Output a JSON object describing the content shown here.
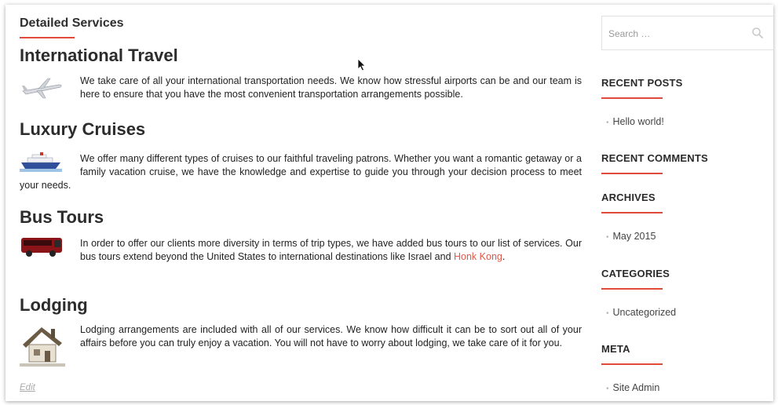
{
  "page": {
    "title": "Detailed Services",
    "edit_label": "Edit"
  },
  "sections": [
    {
      "heading": "International Travel",
      "icon": "airplane-icon",
      "text": "We take care of all your international transportation needs.  We know how stressful airports can be and our team is here to ensure that you have the most convenient transportation arrangements possible."
    },
    {
      "heading": "Luxury Cruises",
      "icon": "cruise-ship-icon",
      "text": "We offer many different types of cruises to our faithful traveling patrons.  Whether you want a romantic getaway or a family vacation cruise, we have the knowledge and expertise to guide you through your decision process to meet your needs."
    },
    {
      "heading": "Bus Tours",
      "icon": "bus-icon",
      "text_before_link": "In order to offer our clients more diversity in terms of trip types, we have added bus tours to our list of services.  Our bus tours extend beyond the United States to international destinations like Israel and ",
      "link": "Honk Kong",
      "text_after_link": "."
    },
    {
      "heading": "Lodging",
      "icon": "house-icon",
      "text": "Lodging arrangements are included with all of our services.  We know how difficult it can be to sort out all of your affairs before you can truly enjoy a vacation.  You will not have to worry about lodging, we take care of it for you."
    }
  ],
  "sidebar": {
    "search": {
      "placeholder": "Search …"
    },
    "recent_posts": {
      "heading": "RECENT POSTS",
      "items": [
        "Hello world!"
      ]
    },
    "recent_comments": {
      "heading": "RECENT COMMENTS"
    },
    "archives": {
      "heading": "ARCHIVES",
      "items": [
        "May 2015"
      ]
    },
    "categories": {
      "heading": "CATEGORIES",
      "items": [
        "Uncategorized"
      ]
    },
    "meta": {
      "heading": "META",
      "items": [
        "Site Admin"
      ]
    }
  },
  "colors": {
    "accent": "#e04a3a",
    "link": "#e0584a",
    "text": "#222222"
  }
}
